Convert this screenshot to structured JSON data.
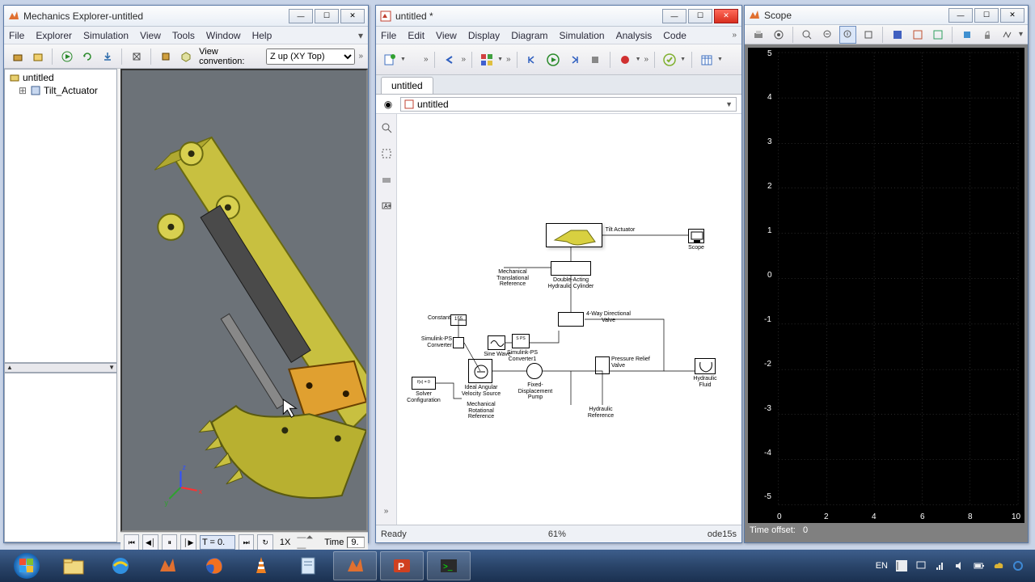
{
  "mech": {
    "title": "Mechanics Explorer-untitled",
    "menu": [
      "File",
      "Explorer",
      "Simulation",
      "View",
      "Tools",
      "Window",
      "Help"
    ],
    "view_conv_label": "View convention:",
    "view_conv_value": "Z up (XY Top)",
    "tree": {
      "root": "untitled",
      "child": "Tilt_Actuator"
    },
    "playback": {
      "speed": "1X",
      "time_label": "Time",
      "time_value": "9.",
      "slider_value": "T = 0."
    }
  },
  "simulink": {
    "title": "untitled *",
    "menu": [
      "File",
      "Edit",
      "View",
      "Display",
      "Diagram",
      "Simulation",
      "Analysis",
      "Code"
    ],
    "tab": "untitled",
    "breadcrumb": "untitled",
    "blocks": {
      "tilt_actuator": "Tilt Actuator",
      "scope": "Scope",
      "mech_trans_ref": "Mechanical Translational Reference",
      "dbl_cylinder": "Double-Acting Hydraulic Cylinder",
      "constant_label": "Constant",
      "constant_val": "155",
      "simulink_ps": "Simulink-PS Converter",
      "simulink_ps2": "Simulink-PS Converter1",
      "sine": "Sine Wave",
      "valve": "4-Way Directional Valve",
      "solver_box": "f(x) = 0",
      "solver": "Solver Configuration",
      "ideal_src": "Ideal Angular Velocity Source",
      "mech_rot_ref": "Mechanical Rotational Reference",
      "pump": "Fixed-Displacement Pump",
      "relief": "Pressure Relief Valve",
      "hyd_ref": "Hydraulic Reference",
      "hyd_fluid": "Hydraulic Fluid",
      "sps": "S PS"
    },
    "status": {
      "ready": "Ready",
      "percent": "61%",
      "solver": "ode15s"
    }
  },
  "scope": {
    "title": "Scope",
    "y_ticks": [
      "5",
      "4",
      "3",
      "2",
      "1",
      "0",
      "-1",
      "-2",
      "-3",
      "-4",
      "-5"
    ],
    "x_ticks": [
      "0",
      "2",
      "4",
      "6",
      "8",
      "10"
    ],
    "time_offset_label": "Time offset:",
    "time_offset_value": "0"
  },
  "taskbar": {
    "lang": "EN"
  }
}
